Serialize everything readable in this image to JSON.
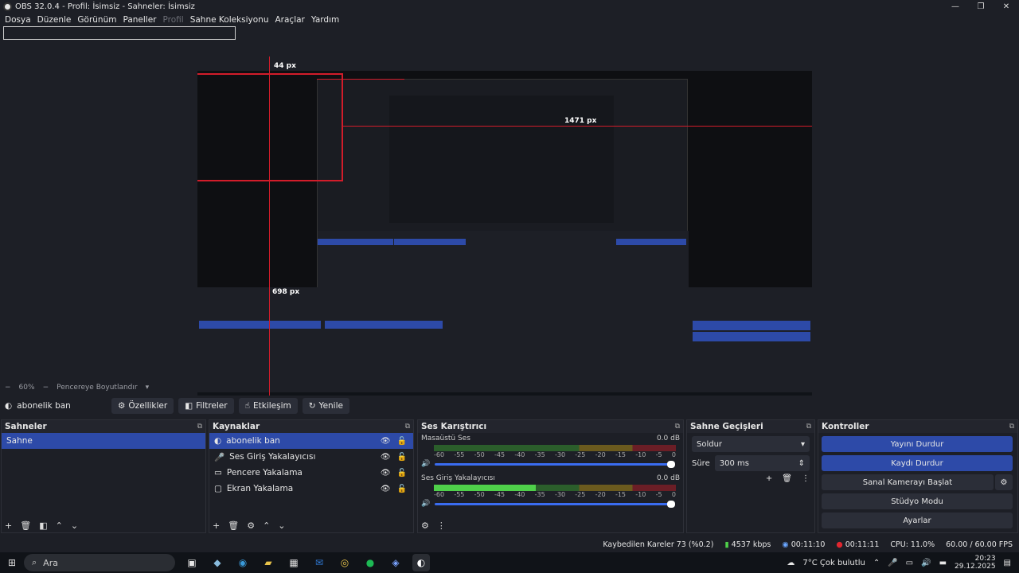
{
  "window": {
    "title": "OBS 32.0.4 - Profil: İsimsiz - Sahneler: İsimsiz",
    "controls": [
      "—",
      "❐",
      "✕"
    ]
  },
  "menu": {
    "items": [
      "Dosya",
      "Düzenle",
      "Görünüm",
      "Paneller",
      "Profil",
      "Sahne Koleksiyonu",
      "Araçlar",
      "Yardım"
    ]
  },
  "preview": {
    "measure_labels": [
      "44 px",
      "1471 px",
      "698 px"
    ],
    "zoom": "60%",
    "fit_label": "Pencereye Boyutlandır"
  },
  "source_toolbar": {
    "source_name": "abonelik ban",
    "properties": "Özellikler",
    "filters": "Filtreler",
    "interact": "Etkileşim",
    "refresh": "Yenile"
  },
  "scenes": {
    "title": "Sahneler",
    "items": [
      "Sahne"
    ]
  },
  "sources": {
    "title": "Kaynaklar",
    "items": [
      {
        "name": "abonelik ban",
        "icon": "browser-icon"
      },
      {
        "name": "Ses Giriş Yakalayıcısı",
        "icon": "microphone-icon"
      },
      {
        "name": "Pencere Yakalama",
        "icon": "window-icon"
      },
      {
        "name": "Ekran Yakalama",
        "icon": "monitor-icon"
      }
    ]
  },
  "mixer": {
    "title": "Ses Karıştırıcı",
    "channels": [
      {
        "name": "Masaüstü Ses",
        "db": "0.0 dB",
        "level": 0.0
      },
      {
        "name": "Ses Giriş Yakalayıcısı",
        "db": "0.0 dB",
        "level": 0.42
      }
    ],
    "scale": [
      "-60",
      "-55",
      "-50",
      "-45",
      "-40",
      "-35",
      "-30",
      "-25",
      "-20",
      "-15",
      "-10",
      "-5",
      "0"
    ]
  },
  "transitions": {
    "title": "Sahne Geçişleri",
    "selected": "Soldur",
    "duration_label": "Süre",
    "duration_value": "300 ms"
  },
  "controls": {
    "title": "Kontroller",
    "stop_stream": "Yayını Durdur",
    "stop_record": "Kaydı Durdur",
    "virtual_cam": "Sanal Kamerayı Başlat",
    "studio_mode": "Stüdyo Modu",
    "settings": "Ayarlar"
  },
  "status": {
    "dropped_frames": "Kaybedilen Kareler 73 (%0.2)",
    "bitrate": "4537 kbps",
    "stream_time": "00:11:10",
    "record_time": "00:11:11",
    "cpu": "CPU: 11.0%",
    "fps": "60.00 / 60.00 FPS"
  },
  "taskbar": {
    "search_placeholder": "Ara",
    "weather": "7°C  Çok bulutlu",
    "time": "20:23",
    "date": "29.12.2025"
  },
  "colors": {
    "accent": "#2d4aa8",
    "record_red": "#e0262f",
    "guide_red": "#d21c2a"
  }
}
